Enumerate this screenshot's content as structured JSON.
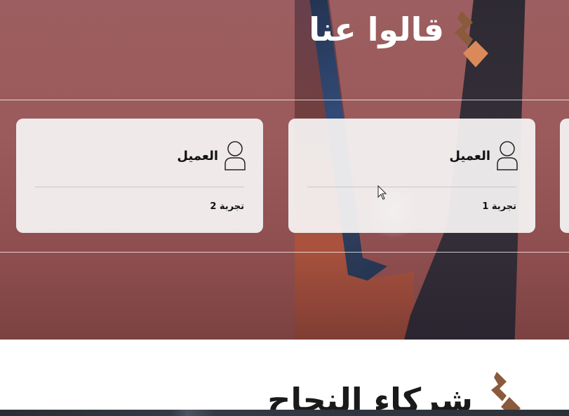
{
  "testimonials": {
    "title": "قالوا عنا",
    "cards": [
      {
        "name": "العميل",
        "text": "تجربة 1",
        "icon": "user-icon"
      },
      {
        "name": "العميل",
        "text": "تجربة 2",
        "icon": "user-icon"
      }
    ]
  },
  "partners": {
    "title": "شركاء النجاح"
  },
  "colors": {
    "accent_dark": "#8a5a3c",
    "accent_light": "#d9895a",
    "card_bg": "#f5f3f3",
    "hero_bg": "#9c5e60"
  }
}
